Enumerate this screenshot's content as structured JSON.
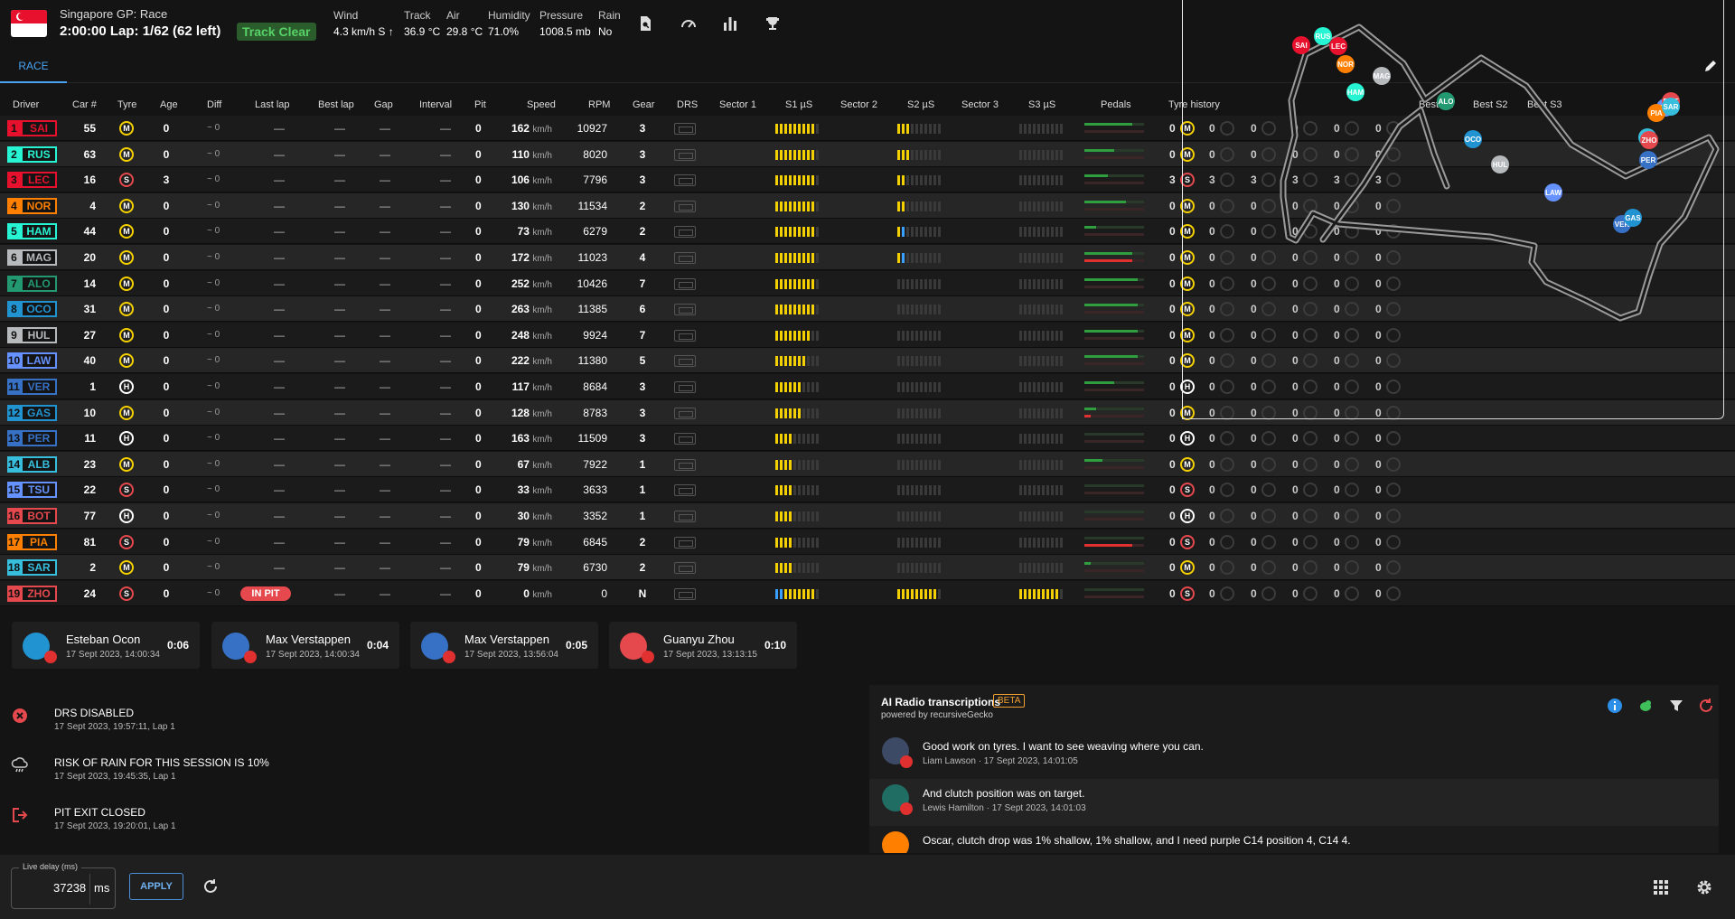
{
  "header": {
    "session_title": "Singapore GP: Race",
    "session_line": "2:00:00 Lap: 1/62 (62 left)",
    "track_status": "Track Clear",
    "weather": [
      {
        "label": "Wind",
        "value": "4.3 km/h S ↑"
      },
      {
        "label": "Track",
        "value": "36.9 °C"
      },
      {
        "label": "Air",
        "value": "29.8 °C"
      },
      {
        "label": "Humidity",
        "value": "71.0%"
      },
      {
        "label": "Pressure",
        "value": "1008.5 mb"
      },
      {
        "label": "Rain",
        "value": "No"
      }
    ],
    "icons": [
      "document-search-icon",
      "speedometer-icon",
      "bar-chart-icon",
      "trophy-icon"
    ]
  },
  "tabs": {
    "race": "RACE"
  },
  "table": {
    "headers": {
      "driver": "Driver",
      "car": "Car #",
      "tyre": "Tyre",
      "age": "Age",
      "diff": "Diff",
      "last_lap": "Last lap",
      "best_lap": "Best lap",
      "gap": "Gap",
      "interval": "Interval",
      "pit": "Pit",
      "speed": "Speed",
      "rpm": "RPM",
      "gear": "Gear",
      "drs": "DRS",
      "sector1": "Sector 1",
      "s1us": "S1 µS",
      "sector2": "Sector 2",
      "s2us": "S2 µS",
      "sector3": "Sector 3",
      "s3us": "S3 µS",
      "pedals": "Pedals",
      "tyre_history": "Tyre history",
      "best_s1": "Best S1",
      "best_s2": "Best S2",
      "best_s3": "Best S3"
    },
    "dash": "—",
    "diff_text": "~ 0",
    "speed_unit": "km/h",
    "pit_badge": "IN PIT",
    "rows": [
      {
        "pos": "1",
        "tla": "SAI",
        "color": "#e8112d",
        "car": "55",
        "tyre": "M",
        "age": "0",
        "pit": "0",
        "speed": "162",
        "rpm": "10927",
        "gear": "3",
        "s1": 0.9,
        "s2": 0.3,
        "s3": 0,
        "thr": 0.8,
        "brk": 0,
        "stint": "0",
        "inpit": false
      },
      {
        "pos": "2",
        "tla": "RUS",
        "color": "#27f4d2",
        "car": "63",
        "tyre": "M",
        "age": "0",
        "pit": "0",
        "speed": "110",
        "rpm": "8020",
        "gear": "3",
        "s1": 0.9,
        "s2": 0.3,
        "s3": 0,
        "thr": 0.5,
        "brk": 0,
        "stint": "0",
        "inpit": false
      },
      {
        "pos": "3",
        "tla": "LEC",
        "color": "#e8112d",
        "car": "16",
        "tyre": "S",
        "age": "3",
        "pit": "0",
        "speed": "106",
        "rpm": "7796",
        "gear": "3",
        "s1": 0.9,
        "s2": 0.2,
        "s3": 0,
        "thr": 0.4,
        "brk": 0,
        "stint": "3",
        "inpit": false
      },
      {
        "pos": "4",
        "tla": "NOR",
        "color": "#ff8000",
        "car": "4",
        "tyre": "M",
        "age": "0",
        "pit": "0",
        "speed": "130",
        "rpm": "11534",
        "gear": "2",
        "s1": 0.9,
        "s2": 0.2,
        "s3": 0,
        "thr": 0.7,
        "brk": 0,
        "stint": "0",
        "inpit": false
      },
      {
        "pos": "5",
        "tla": "HAM",
        "color": "#27f4d2",
        "car": "44",
        "tyre": "M",
        "age": "0",
        "pit": "0",
        "speed": "73",
        "rpm": "6279",
        "gear": "2",
        "s1": 0.9,
        "s2": 0.1,
        "s3": 0,
        "thr": 0.2,
        "brk": 0,
        "stint": "0",
        "inpit": false
      },
      {
        "pos": "6",
        "tla": "MAG",
        "color": "#b6babd",
        "car": "20",
        "tyre": "M",
        "age": "0",
        "pit": "0",
        "speed": "172",
        "rpm": "11023",
        "gear": "4",
        "s1": 0.9,
        "s2": 0.1,
        "s3": 0,
        "thr": 0.8,
        "brk": 0.8,
        "stint": "0",
        "inpit": false
      },
      {
        "pos": "7",
        "tla": "ALO",
        "color": "#229971",
        "car": "14",
        "tyre": "M",
        "age": "0",
        "pit": "0",
        "speed": "252",
        "rpm": "10426",
        "gear": "7",
        "s1": 0.9,
        "s2": 0,
        "s3": 0,
        "thr": 0.9,
        "brk": 0,
        "stint": "0",
        "inpit": false
      },
      {
        "pos": "8",
        "tla": "OCO",
        "color": "#2293d1",
        "car": "31",
        "tyre": "M",
        "age": "0",
        "pit": "0",
        "speed": "263",
        "rpm": "11385",
        "gear": "6",
        "s1": 0.9,
        "s2": 0,
        "s3": 0,
        "thr": 0.9,
        "brk": 0,
        "stint": "0",
        "inpit": false
      },
      {
        "pos": "9",
        "tla": "HUL",
        "color": "#b6babd",
        "car": "27",
        "tyre": "M",
        "age": "0",
        "pit": "0",
        "speed": "248",
        "rpm": "9924",
        "gear": "7",
        "s1": 0.8,
        "s2": 0,
        "s3": 0,
        "thr": 0.9,
        "brk": 0,
        "stint": "0",
        "inpit": false
      },
      {
        "pos": "10",
        "tla": "LAW",
        "color": "#6692ff",
        "car": "40",
        "tyre": "M",
        "age": "0",
        "pit": "0",
        "speed": "222",
        "rpm": "11380",
        "gear": "5",
        "s1": 0.7,
        "s2": 0,
        "s3": 0,
        "thr": 0.9,
        "brk": 0,
        "stint": "0",
        "inpit": false
      },
      {
        "pos": "11",
        "tla": "VER",
        "color": "#3671c6",
        "car": "1",
        "tyre": "H",
        "age": "0",
        "pit": "0",
        "speed": "117",
        "rpm": "8684",
        "gear": "3",
        "s1": 0.6,
        "s2": 0,
        "s3": 0,
        "thr": 0.5,
        "brk": 0,
        "stint": "0",
        "inpit": false
      },
      {
        "pos": "12",
        "tla": "GAS",
        "color": "#2293d1",
        "car": "10",
        "tyre": "M",
        "age": "0",
        "pit": "0",
        "speed": "128",
        "rpm": "8783",
        "gear": "3",
        "s1": 0.6,
        "s2": 0,
        "s3": 0,
        "thr": 0.2,
        "brk": 0.1,
        "stint": "0",
        "inpit": false
      },
      {
        "pos": "13",
        "tla": "PER",
        "color": "#3671c6",
        "car": "11",
        "tyre": "H",
        "age": "0",
        "pit": "0",
        "speed": "163",
        "rpm": "11509",
        "gear": "3",
        "s1": 0.4,
        "s2": 0,
        "s3": 0,
        "thr": 0,
        "brk": 0,
        "stint": "0",
        "inpit": false
      },
      {
        "pos": "14",
        "tla": "ALB",
        "color": "#37bedd",
        "car": "23",
        "tyre": "M",
        "age": "0",
        "pit": "0",
        "speed": "67",
        "rpm": "7922",
        "gear": "1",
        "s1": 0.4,
        "s2": 0,
        "s3": 0,
        "thr": 0.3,
        "brk": 0,
        "stint": "0",
        "inpit": false
      },
      {
        "pos": "15",
        "tla": "TSU",
        "color": "#6692ff",
        "car": "22",
        "tyre": "S",
        "age": "0",
        "pit": "0",
        "speed": "33",
        "rpm": "3633",
        "gear": "1",
        "s1": 0.4,
        "s2": 0,
        "s3": 0,
        "thr": 0,
        "brk": 0,
        "stint": "0",
        "inpit": false
      },
      {
        "pos": "16",
        "tla": "BOT",
        "color": "#e5484d",
        "car": "77",
        "tyre": "H",
        "age": "0",
        "pit": "0",
        "speed": "30",
        "rpm": "3352",
        "gear": "1",
        "s1": 0.4,
        "s2": 0,
        "s3": 0,
        "thr": 0,
        "brk": 0,
        "stint": "0",
        "inpit": false
      },
      {
        "pos": "17",
        "tla": "PIA",
        "color": "#ff8000",
        "car": "81",
        "tyre": "S",
        "age": "0",
        "pit": "0",
        "speed": "79",
        "rpm": "6845",
        "gear": "2",
        "s1": 0.4,
        "s2": 0,
        "s3": 0,
        "thr": 0,
        "brk": 0.8,
        "stint": "0",
        "inpit": false
      },
      {
        "pos": "18",
        "tla": "SAR",
        "color": "#37bedd",
        "car": "2",
        "tyre": "M",
        "age": "0",
        "pit": "0",
        "speed": "79",
        "rpm": "6730",
        "gear": "2",
        "s1": 0.4,
        "s2": 0,
        "s3": 0,
        "thr": 0.1,
        "brk": 0,
        "stint": "0",
        "inpit": false
      },
      {
        "pos": "19",
        "tla": "ZHO",
        "color": "#e5484d",
        "car": "24",
        "tyre": "S",
        "age": "0",
        "pit": "0",
        "speed": "0",
        "rpm": "0",
        "gear": "N",
        "s1": 0.9,
        "s2": 0.9,
        "s3": 0.9,
        "thr": 0,
        "brk": 0,
        "stint": "0",
        "inpit": true
      }
    ]
  },
  "map": {
    "cars": [
      "SAI",
      "RUS",
      "LEC",
      "NOR",
      "HAM",
      "MAG",
      "ALO",
      "OCO",
      "HUL",
      "LAW",
      "VER",
      "GAS",
      "PER",
      "ALB",
      "TSU",
      "BOT",
      "PIA",
      "SAR",
      "ZHO"
    ]
  },
  "radios": [
    {
      "name": "Esteban Ocon",
      "date": "17 Sept 2023, 14:00:34",
      "duration": "0:06",
      "color": "#2293d1"
    },
    {
      "name": "Max Verstappen",
      "date": "17 Sept 2023, 14:00:34",
      "duration": "0:04",
      "color": "#3671c6"
    },
    {
      "name": "Max Verstappen",
      "date": "17 Sept 2023, 13:56:04",
      "duration": "0:05",
      "color": "#3671c6"
    },
    {
      "name": "Guanyu Zhou",
      "date": "17 Sept 2023, 13:13:15",
      "duration": "0:10",
      "color": "#e5484d"
    }
  ],
  "race_control": [
    {
      "icon": "close-circle-icon",
      "message": "DRS DISABLED",
      "time": "17 Sept 2023, 19:57:11, Lap 1",
      "color": "#e5484d"
    },
    {
      "icon": "rain-cloud-icon",
      "message": "RISK OF RAIN FOR THIS SESSION IS 10%",
      "time": "17 Sept 2023, 19:45:35, Lap 1",
      "color": "#cccccc"
    },
    {
      "icon": "exit-icon",
      "message": "PIT EXIT CLOSED",
      "time": "17 Sept 2023, 19:20:01, Lap 1",
      "color": "#e5484d"
    }
  ],
  "ai_panel": {
    "title": "AI Radio transcriptions",
    "beta": "BETA",
    "powered_by": "powered by recursiveGecko",
    "items": [
      {
        "text": "Good work on tyres. I want to see weaving where you can.",
        "meta": "Liam Lawson · 17 Sept 2023, 14:01:05",
        "color": "#6692ff"
      },
      {
        "text": "And clutch position was on target.",
        "meta": "Lewis Hamilton · 17 Sept 2023, 14:01:03",
        "color": "#27f4d2"
      },
      {
        "text": "Oscar, clutch drop was 1% shallow, 1% shallow, and I need purple C14 position 4, C14 4.",
        "meta": "",
        "color": "#ff8000"
      }
    ]
  },
  "footer": {
    "delay_label": "Live delay (ms)",
    "delay_value": "37238",
    "delay_unit": "ms",
    "apply": "APPLY"
  }
}
